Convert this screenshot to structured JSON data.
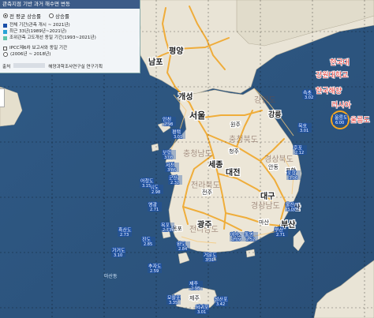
{
  "panel": {
    "title": "관측지점 기반 과거 해수면 변동",
    "radio_options": [
      "전 평균 상승률",
      "상승률"
    ],
    "radio_selected": 0,
    "options": [
      "전체 기간(관측 개시 ~ 2021년)",
      "최근 33년(1989년~2021년)",
      "조위관측 고도개선 동일 기간(1993~2021년)",
      "IPCC제6차 보고서와 동일 기간",
      "(2006년 ~ 2018년)"
    ],
    "footer_label": "출처",
    "footer_text": "해양과학조사연구실 연구기획"
  },
  "colors": {
    "water": "#3a5e84",
    "land": "#ebe5d8",
    "roads": "#f0a72a",
    "grid": "#000000",
    "marker": "#1a4fa8",
    "ulleung_marker": "#f5a623"
  },
  "cities": [
    {
      "name": "평양",
      "size": "large"
    },
    {
      "name": "남포",
      "size": "large"
    },
    {
      "name": "개성",
      "size": "large"
    },
    {
      "name": "서울",
      "size": "large"
    },
    {
      "name": "강릉",
      "size": "large"
    },
    {
      "name": "세종",
      "size": "large"
    },
    {
      "name": "대전",
      "size": "large"
    },
    {
      "name": "대구",
      "size": "large"
    },
    {
      "name": "울산",
      "size": "large"
    },
    {
      "name": "광주",
      "size": "large"
    },
    {
      "name": "부산",
      "size": "large"
    },
    {
      "name": "포항",
      "size": "small"
    },
    {
      "name": "원주",
      "size": "small"
    },
    {
      "name": "청주",
      "size": "small"
    },
    {
      "name": "전주",
      "size": "small"
    },
    {
      "name": "목포",
      "size": "small"
    },
    {
      "name": "여수",
      "size": "small"
    },
    {
      "name": "마산",
      "size": "small"
    },
    {
      "name": "안동",
      "size": "small"
    },
    {
      "name": "제주",
      "size": "small"
    }
  ],
  "provinces": [
    "강원도",
    "경상북도",
    "전라북도",
    "경상남도",
    "전라남도",
    "충청북도",
    "충청남도"
  ],
  "foreign_labels": [
    "한국대",
    "강원대학교",
    "한국해양",
    "러시아",
    "울릉도"
  ],
  "sea_labels": [
    "마산동"
  ],
  "stations": [
    {
      "label": "인천",
      "value": "2.98"
    },
    {
      "label": "평택",
      "value": "3.01"
    },
    {
      "label": "보령",
      "value": "3.08"
    },
    {
      "label": "서천",
      "value": "3.86"
    },
    {
      "label": "군산",
      "value": "2.32"
    },
    {
      "label": "위도",
      "value": "2.98"
    },
    {
      "label": "영광",
      "value": "2.71"
    },
    {
      "label": "목포",
      "value": "2.73"
    },
    {
      "label": "흑산도",
      "value": "2.73"
    },
    {
      "label": "진도",
      "value": "2.85"
    },
    {
      "label": "완도",
      "value": "2.84"
    },
    {
      "label": "거문도",
      "value": "3.31"
    },
    {
      "label": "여수",
      "value": "2.09"
    },
    {
      "label": "통영",
      "value": "2.52"
    },
    {
      "label": "부산",
      "value": "2.71"
    },
    {
      "label": "울산",
      "value": "3.07"
    },
    {
      "label": "포항",
      "value": "3.06"
    },
    {
      "label": "후포",
      "value": "2.12"
    },
    {
      "label": "묵호",
      "value": "3.01"
    },
    {
      "label": "속초",
      "value": "3.02"
    },
    {
      "label": "제주",
      "value": "2.98"
    },
    {
      "label": "서귀포",
      "value": "3.01"
    },
    {
      "label": "모슬포",
      "value": "3.35"
    },
    {
      "label": "성산포",
      "value": "3.42"
    },
    {
      "label": "추자도",
      "value": "2.59"
    },
    {
      "label": "가거도",
      "value": "3.10"
    },
    {
      "label": "어청도",
      "value": "3.15"
    }
  ],
  "ulleung_marker": {
    "label": "울릉도",
    "value": "6.00"
  }
}
